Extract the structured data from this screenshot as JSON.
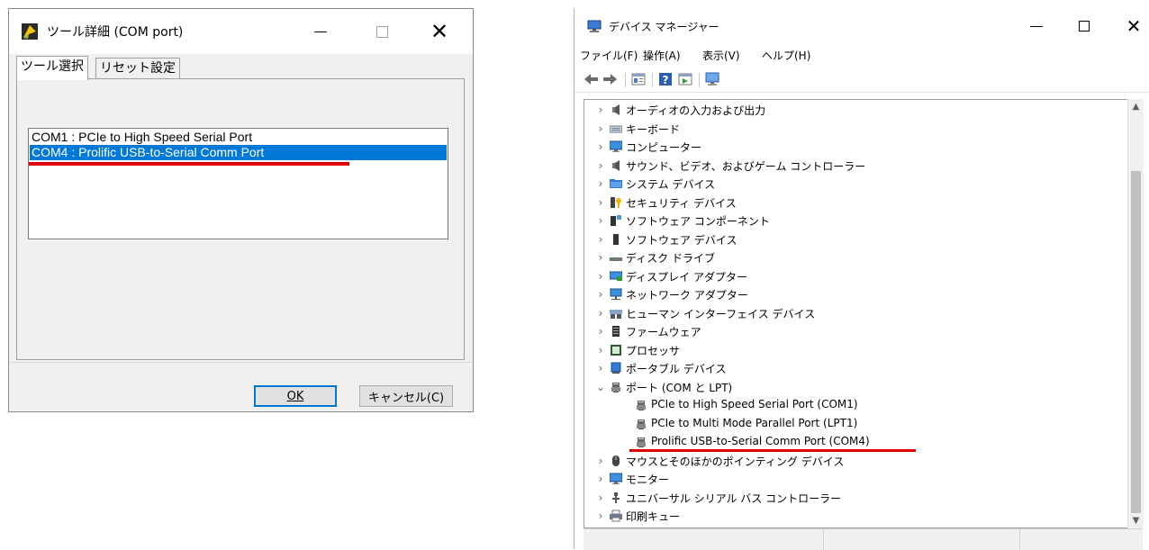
{
  "dialog": {
    "title": "ツール詳細 (COM port)",
    "tabs": [
      "ツール選択",
      "リセット設定"
    ],
    "ports": [
      "COM1 : PCIe to High Speed Serial Port",
      "COM4 : Prolific USB-to-Serial Comm Port"
    ],
    "selected_index": 1,
    "ok_label": "OK",
    "cancel_label": "キャンセル(C)"
  },
  "devmgr": {
    "title": "デバイス マネージャー",
    "menu": [
      "ファイル(F)",
      "操作(A)",
      "表示(V)",
      "ヘルプ(H)"
    ],
    "tree": [
      {
        "label": "オーディオの入力および出力",
        "icon": "speaker-icon",
        "level": 0,
        "state": "collapsed"
      },
      {
        "label": "キーボード",
        "icon": "keyboard-icon",
        "level": 0,
        "state": "collapsed"
      },
      {
        "label": "コンピューター",
        "icon": "monitor-icon",
        "level": 0,
        "state": "collapsed"
      },
      {
        "label": "サウンド、ビデオ、およびゲーム コントローラー",
        "icon": "speaker-icon",
        "level": 0,
        "state": "collapsed"
      },
      {
        "label": "システム デバイス",
        "icon": "folder-icon",
        "level": 0,
        "state": "collapsed"
      },
      {
        "label": "セキュリティ デバイス",
        "icon": "key-icon",
        "level": 0,
        "state": "collapsed"
      },
      {
        "label": "ソフトウェア コンポーネント",
        "icon": "component-icon",
        "level": 0,
        "state": "collapsed"
      },
      {
        "label": "ソフトウェア デバイス",
        "icon": "device-icon",
        "level": 0,
        "state": "collapsed"
      },
      {
        "label": "ディスク ドライブ",
        "icon": "disk-icon",
        "level": 0,
        "state": "collapsed"
      },
      {
        "label": "ディスプレイ アダプター",
        "icon": "display-adapter-icon",
        "level": 0,
        "state": "collapsed"
      },
      {
        "label": "ネットワーク アダプター",
        "icon": "network-icon",
        "level": 0,
        "state": "collapsed"
      },
      {
        "label": "ヒューマン インターフェイス デバイス",
        "icon": "hid-icon",
        "level": 0,
        "state": "collapsed"
      },
      {
        "label": "ファームウェア",
        "icon": "firmware-icon",
        "level": 0,
        "state": "collapsed"
      },
      {
        "label": "プロセッサ",
        "icon": "processor-icon",
        "level": 0,
        "state": "collapsed"
      },
      {
        "label": "ポータブル デバイス",
        "icon": "portable-icon",
        "level": 0,
        "state": "collapsed"
      },
      {
        "label": "ポート (COM と LPT)",
        "icon": "port-icon",
        "level": 0,
        "state": "expanded"
      },
      {
        "label": "PCIe to High Speed Serial Port (COM1)",
        "icon": "port-icon",
        "level": 1,
        "state": "leaf"
      },
      {
        "label": "PCIe to Multi Mode Parallel Port (LPT1)",
        "icon": "port-icon",
        "level": 1,
        "state": "leaf"
      },
      {
        "label": "Prolific USB-to-Serial Comm Port (COM4)",
        "icon": "port-icon",
        "level": 1,
        "state": "leaf"
      },
      {
        "label": "マウスとそのほかのポインティング デバイス",
        "icon": "mouse-icon",
        "level": 0,
        "state": "collapsed"
      },
      {
        "label": "モニター",
        "icon": "monitor-icon",
        "level": 0,
        "state": "collapsed"
      },
      {
        "label": "ユニバーサル シリアル バス コントローラー",
        "icon": "usb-icon",
        "level": 0,
        "state": "collapsed"
      },
      {
        "label": "印刷キュー",
        "icon": "printer-icon",
        "level": 0,
        "state": "collapsed"
      }
    ]
  },
  "colors": {
    "highlight": "#e10000",
    "selection": "#0078d7"
  }
}
